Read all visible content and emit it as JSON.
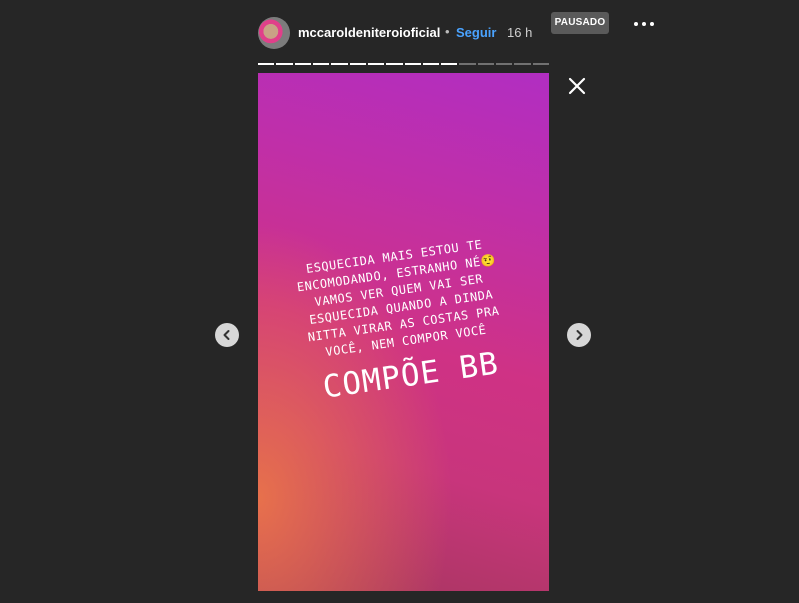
{
  "header": {
    "username": "mccaroldeniteroioficial",
    "separator": "•",
    "follow_label": "Seguir",
    "time": "16 h",
    "status_badge": "PAUSADO"
  },
  "progress": {
    "total_segments": 16,
    "completed_segments": 11
  },
  "story": {
    "lines": [
      "ESQUECIDA MAIS ESTOU TE",
      "ENCOMODANDO, ESTRANHO NÉ🤨",
      "VAMOS VER QUEM VAI SER",
      "ESQUECIDA QUANDO A DINDA",
      "NITTA VIRAR AS COSTAS PRA",
      "VOCÊ, NEM COMPOR VOCÊ"
    ],
    "headline": "COMPÕE BB"
  },
  "icons": {
    "close": "close-icon",
    "prev": "chevron-left-icon",
    "next": "chevron-right-icon",
    "more": "more-options-icon",
    "avatar": "profile-avatar"
  }
}
